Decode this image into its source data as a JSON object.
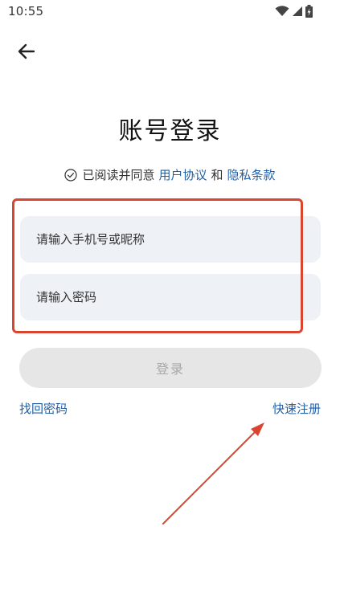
{
  "status_bar": {
    "time": "10:55",
    "icons": [
      "wifi-icon",
      "signal-icon",
      "battery-icon"
    ]
  },
  "header": {
    "back_icon": "arrow-left-icon"
  },
  "title": "账号登录",
  "agreement": {
    "prefix": "已阅读并同意",
    "user_agreement": "用户协议",
    "conjunction": "和",
    "privacy_policy": "隐私条款"
  },
  "form": {
    "account_placeholder": "请输入手机号或昵称",
    "account_value": "",
    "password_placeholder": "请输入密码",
    "password_value": "",
    "login_label": "登录"
  },
  "links": {
    "forgot_password": "找回密码",
    "quick_register": "快速注册"
  },
  "colors": {
    "link": "#1f5fa8",
    "annotation": "#d9452f",
    "input_bg": "#eef1f5",
    "button_disabled_bg": "#e6e6e6"
  }
}
